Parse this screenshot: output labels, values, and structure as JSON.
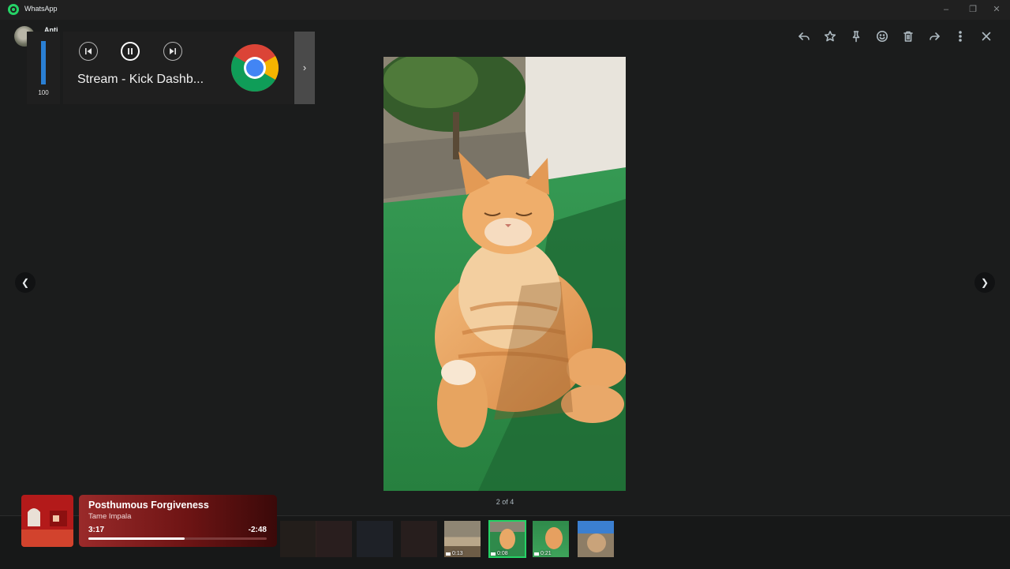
{
  "window": {
    "app_title": "WhatsApp"
  },
  "viewer": {
    "sender_name": "Anti",
    "counter": "2 of 4",
    "toolbar": [
      "reply-icon",
      "star-icon",
      "pin-icon",
      "emoji-icon",
      "delete-icon",
      "forward-icon",
      "more-icon",
      "close-icon"
    ]
  },
  "media_overlay": {
    "volume": 100,
    "volume_label": "100",
    "media_title": "Stream - Kick Dashb...",
    "source_icon": "chrome-icon"
  },
  "now_playing": {
    "title": "Posthumous Forgiveness",
    "artist": "Tame Impala",
    "elapsed": "3:17",
    "remaining": "-2:48",
    "progress": 0.54
  },
  "thumbnails": [
    {
      "duration": "0:13"
    },
    {
      "duration": "0:08",
      "selected": true
    },
    {
      "duration": "0:21"
    },
    {
      "duration": ""
    }
  ],
  "colors": {
    "accent": "#25d366",
    "volume_fill": "#2a7fd4",
    "now_playing_bg": "#7a1d1d"
  }
}
